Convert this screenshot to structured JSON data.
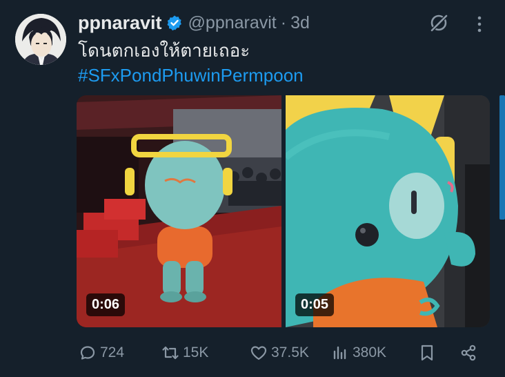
{
  "tweet": {
    "display_name": "ppnaravit",
    "handle": "@ppnaravit",
    "separator": "·",
    "time": "3d",
    "text": "โดนตกเองให้ตายเถอะ",
    "hashtag": "#SFxPondPhuwinPermpoon",
    "verified": true
  },
  "media": [
    {
      "duration": "0:06",
      "icon": "video-thumbnail-mascot-stage"
    },
    {
      "duration": "0:05",
      "icon": "video-thumbnail-mascot-closeup"
    }
  ],
  "actions": {
    "replies": "724",
    "reposts": "15K",
    "likes": "37.5K",
    "views": "380K"
  },
  "colors": {
    "background": "#15202b",
    "text": "#e7e9ea",
    "muted": "#8b98a5",
    "accent": "#1d9bf0"
  }
}
